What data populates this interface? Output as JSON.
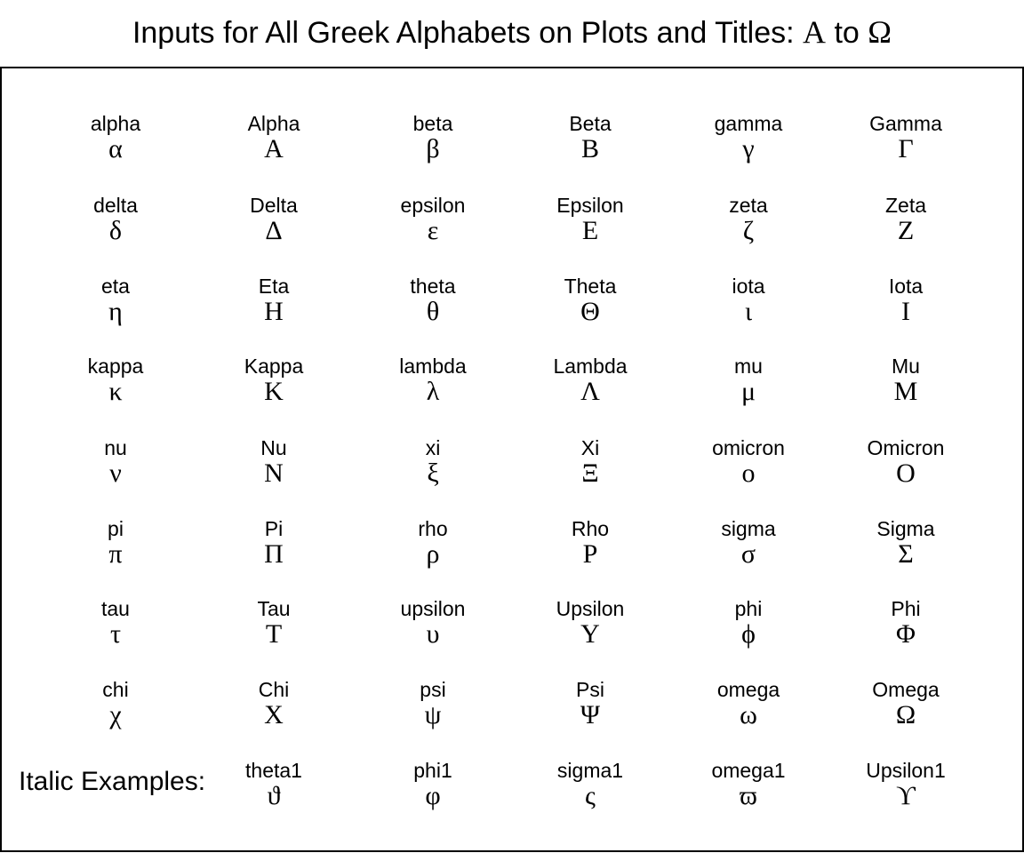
{
  "title": {
    "text": "Inputs for All Greek Alphabets on Plots and Titles: ",
    "sym_start": "Α",
    "mid": " to ",
    "sym_end": "Ω"
  },
  "grid": [
    [
      {
        "label": "alpha",
        "glyph": "α"
      },
      {
        "label": "Alpha",
        "glyph": "Α"
      },
      {
        "label": "beta",
        "glyph": "β"
      },
      {
        "label": "Beta",
        "glyph": "Β"
      },
      {
        "label": "gamma",
        "glyph": "γ"
      },
      {
        "label": "Gamma",
        "glyph": "Γ"
      }
    ],
    [
      {
        "label": "delta",
        "glyph": "δ"
      },
      {
        "label": "Delta",
        "glyph": "Δ"
      },
      {
        "label": "epsilon",
        "glyph": "ε"
      },
      {
        "label": "Epsilon",
        "glyph": "Ε"
      },
      {
        "label": "zeta",
        "glyph": "ζ"
      },
      {
        "label": "Zeta",
        "glyph": "Ζ"
      }
    ],
    [
      {
        "label": "eta",
        "glyph": "η"
      },
      {
        "label": "Eta",
        "glyph": "Η"
      },
      {
        "label": "theta",
        "glyph": "θ"
      },
      {
        "label": "Theta",
        "glyph": "Θ"
      },
      {
        "label": "iota",
        "glyph": "ι"
      },
      {
        "label": "Iota",
        "glyph": "Ι"
      }
    ],
    [
      {
        "label": "kappa",
        "glyph": "κ"
      },
      {
        "label": "Kappa",
        "glyph": "Κ"
      },
      {
        "label": "lambda",
        "glyph": "λ"
      },
      {
        "label": "Lambda",
        "glyph": "Λ"
      },
      {
        "label": "mu",
        "glyph": "μ"
      },
      {
        "label": "Mu",
        "glyph": "Μ"
      }
    ],
    [
      {
        "label": "nu",
        "glyph": "ν"
      },
      {
        "label": "Nu",
        "glyph": "Ν"
      },
      {
        "label": "xi",
        "glyph": "ξ"
      },
      {
        "label": "Xi",
        "glyph": "Ξ"
      },
      {
        "label": "omicron",
        "glyph": "ο"
      },
      {
        "label": "Omicron",
        "glyph": "Ο"
      }
    ],
    [
      {
        "label": "pi",
        "glyph": "π"
      },
      {
        "label": "Pi",
        "glyph": "Π"
      },
      {
        "label": "rho",
        "glyph": "ρ"
      },
      {
        "label": "Rho",
        "glyph": "Ρ"
      },
      {
        "label": "sigma",
        "glyph": "σ"
      },
      {
        "label": "Sigma",
        "glyph": "Σ"
      }
    ],
    [
      {
        "label": "tau",
        "glyph": "τ"
      },
      {
        "label": "Tau",
        "glyph": "Τ"
      },
      {
        "label": "upsilon",
        "glyph": "υ"
      },
      {
        "label": "Upsilon",
        "glyph": "Υ"
      },
      {
        "label": "phi",
        "glyph": "ϕ"
      },
      {
        "label": "Phi",
        "glyph": "Φ"
      }
    ],
    [
      {
        "label": "chi",
        "glyph": "χ"
      },
      {
        "label": "Chi",
        "glyph": "Χ"
      },
      {
        "label": "psi",
        "glyph": "ψ"
      },
      {
        "label": "Psi",
        "glyph": "Ψ"
      },
      {
        "label": "omega",
        "glyph": "ω"
      },
      {
        "label": "Omega",
        "glyph": "Ω"
      }
    ]
  ],
  "italic_section": {
    "heading": "Italic Examples:",
    "items": [
      {
        "label": "theta1",
        "glyph": "ϑ"
      },
      {
        "label": "phi1",
        "glyph": "φ"
      },
      {
        "label": "sigma1",
        "glyph": "ς"
      },
      {
        "label": "omega1",
        "glyph": "ϖ"
      },
      {
        "label": "Upsilon1",
        "glyph": "ϒ"
      }
    ]
  }
}
